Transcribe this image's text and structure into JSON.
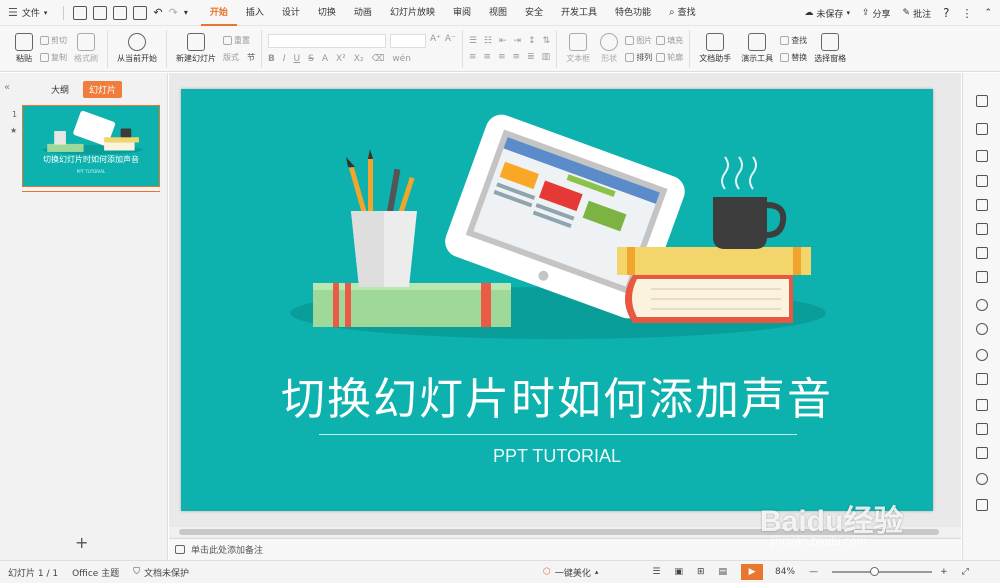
{
  "menubar": {
    "file_label": "文件",
    "tabs": [
      {
        "label": "开始",
        "active": true
      },
      {
        "label": "插入"
      },
      {
        "label": "设计"
      },
      {
        "label": "切换"
      },
      {
        "label": "动画"
      },
      {
        "label": "幻灯片放映"
      },
      {
        "label": "审阅"
      },
      {
        "label": "视图"
      },
      {
        "label": "安全"
      },
      {
        "label": "开发工具"
      },
      {
        "label": "特色功能"
      }
    ],
    "search_label": "查找",
    "unsaved_label": "未保存",
    "share_label": "分享",
    "comment_label": "批注",
    "help_label": "?"
  },
  "ribbon": {
    "paste": "粘贴",
    "cut": "剪切",
    "copy": "复制",
    "format_painter": "格式刷",
    "from_current": "从当前开始",
    "new_slide": "新建幻灯片",
    "layout": "版式",
    "section": "节",
    "reset": "重置",
    "text_box": "文本框",
    "shape": "形状",
    "picture": "图片",
    "arrange": "排列",
    "fill": "填充",
    "outline": "轮廓",
    "doc_assistant": "文档助手",
    "present_tools": "演示工具",
    "find": "查找",
    "replace": "替换",
    "select_pane": "选择窗格"
  },
  "leftpanel": {
    "outline_tab": "大纲",
    "slides_tab": "幻灯片",
    "slide_number": "1",
    "thumb_title": "切换幻灯片时如何添加声音",
    "thumb_sub": "PPT TUTORIAL"
  },
  "slide": {
    "title": "切换幻灯片时如何添加声音",
    "subtitle": "PPT TUTORIAL"
  },
  "notes": {
    "placeholder": "单击此处添加备注"
  },
  "statusbar": {
    "slide_count": "幻灯片 1 / 1",
    "theme": "Office 主题",
    "protection": "文档未保护",
    "beautify": "一键美化",
    "zoom": "84%"
  },
  "watermark": {
    "brand": "Baidu经验",
    "site": "jingyan.baidu.com"
  },
  "colors": {
    "accent": "#e8762d",
    "slide_bg": "#0db1ad"
  }
}
